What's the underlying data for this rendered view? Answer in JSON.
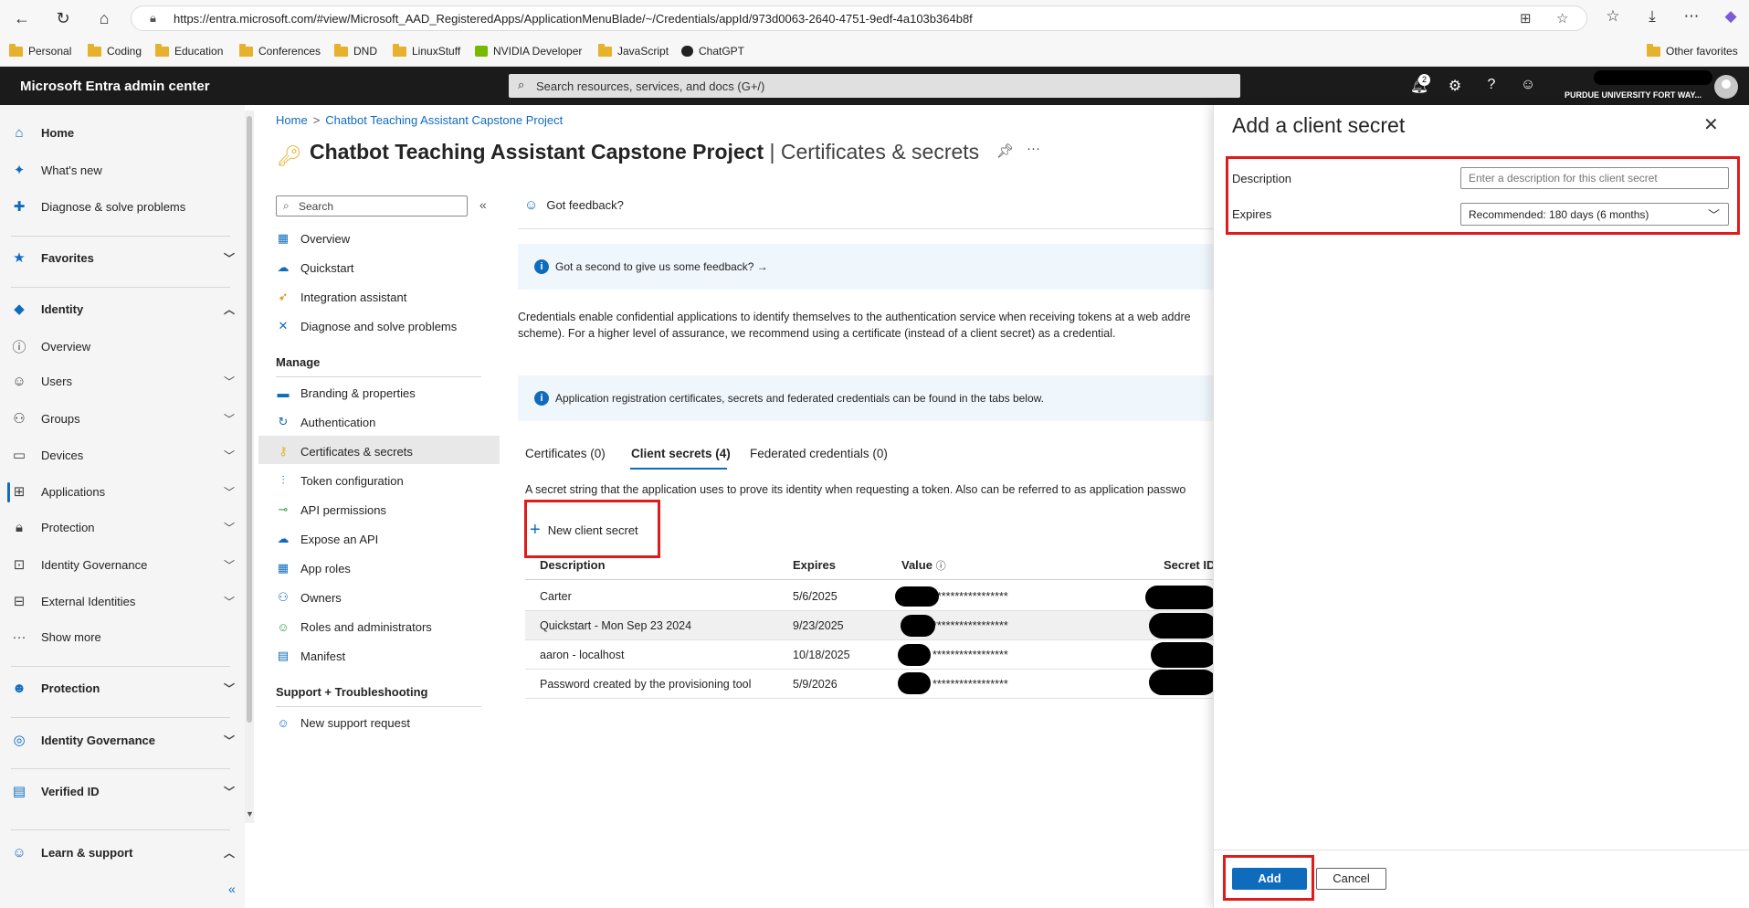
{
  "browser": {
    "url": "https://entra.microsoft.com/#view/Microsoft_AAD_RegisteredApps/ApplicationMenuBlade/~/Credentials/appId/973d0063-2640-4751-9edf-4a103b364b8f",
    "bookmarks": [
      "Personal",
      "Coding",
      "Education",
      "Conferences",
      "DND",
      "LinuxStuff",
      "NVIDIA Developer",
      "JavaScript",
      "ChatGPT"
    ],
    "other_favorites": "Other favorites"
  },
  "topbar": {
    "app_title": "Microsoft Entra admin center",
    "search_placeholder": "Search resources, services, and docs (G+/)",
    "notification_count": "2",
    "org_name": "PURDUE UNIVERSITY FORT WAY..."
  },
  "leftnav": {
    "home": "Home",
    "whats_new": "What's new",
    "diagnose": "Diagnose & solve problems",
    "favorites": "Favorites",
    "identity": "Identity",
    "identity_items": [
      "Overview",
      "Users",
      "Groups",
      "Devices",
      "Applications",
      "Protection",
      "Identity Governance",
      "External Identities",
      "Show more"
    ],
    "protection": "Protection",
    "identity_governance": "Identity Governance",
    "verified_id": "Verified ID",
    "learn_support": "Learn & support"
  },
  "breadcrumb": {
    "home": "Home",
    "app": "Chatbot Teaching Assistant Capstone Project"
  },
  "page": {
    "title_app": "Chatbot Teaching Assistant Capstone Project",
    "title_section": " | Certificates & secrets"
  },
  "resource_menu": {
    "search_placeholder": "Search",
    "items_top": [
      "Overview",
      "Quickstart",
      "Integration assistant",
      "Diagnose and solve problems"
    ],
    "manage_heading": "Manage",
    "manage_items": [
      "Branding & properties",
      "Authentication",
      "Certificates & secrets",
      "Token configuration",
      "API permissions",
      "Expose an API",
      "App roles",
      "Owners",
      "Roles and administrators",
      "Manifest"
    ],
    "support_heading": "Support + Troubleshooting",
    "support_items": [
      "New support request"
    ]
  },
  "content": {
    "feedback_link": "Got feedback?",
    "feedback_banner": "Got a second to give us some feedback? →",
    "description_line1": "Credentials enable confidential applications to identify themselves to the authentication service when receiving tokens at a web addre",
    "description_line2": "scheme). For a higher level of assurance, we recommend using a certificate (instead of a client secret) as a credential.",
    "info_banner": "Application registration certificates, secrets and federated credentials can be found in the tabs below.",
    "tabs": [
      "Certificates (0)",
      "Client secrets (4)",
      "Federated credentials (0)"
    ],
    "secret_description": "A secret string that the application uses to prove its identity when requesting a token. Also can be referred to as application passwo",
    "new_secret_button": "New client secret",
    "table_headers": {
      "description": "Description",
      "expires": "Expires",
      "value": "Value",
      "secret_id": "Secret ID"
    },
    "rows": [
      {
        "description": "Carter",
        "expires": "5/6/2025",
        "value": "*****************"
      },
      {
        "description": "Quickstart - Mon Sep 23 2024",
        "expires": "9/23/2025",
        "value": "*****************"
      },
      {
        "description": "aaron - localhost",
        "expires": "10/18/2025",
        "value": "*****************"
      },
      {
        "description": "Password created by the provisioning tool",
        "expires": "5/9/2026",
        "value": "*****************"
      }
    ]
  },
  "panel": {
    "title": "Add a client secret",
    "description_label": "Description",
    "description_placeholder": "Enter a description for this client secret",
    "expires_label": "Expires",
    "expires_value": "Recommended: 180 days (6 months)",
    "add_button": "Add",
    "cancel_button": "Cancel"
  },
  "colors": {
    "accent": "#0f6cbd",
    "highlight_box": "#e01b1b",
    "topbar": "#1b1b1b"
  }
}
